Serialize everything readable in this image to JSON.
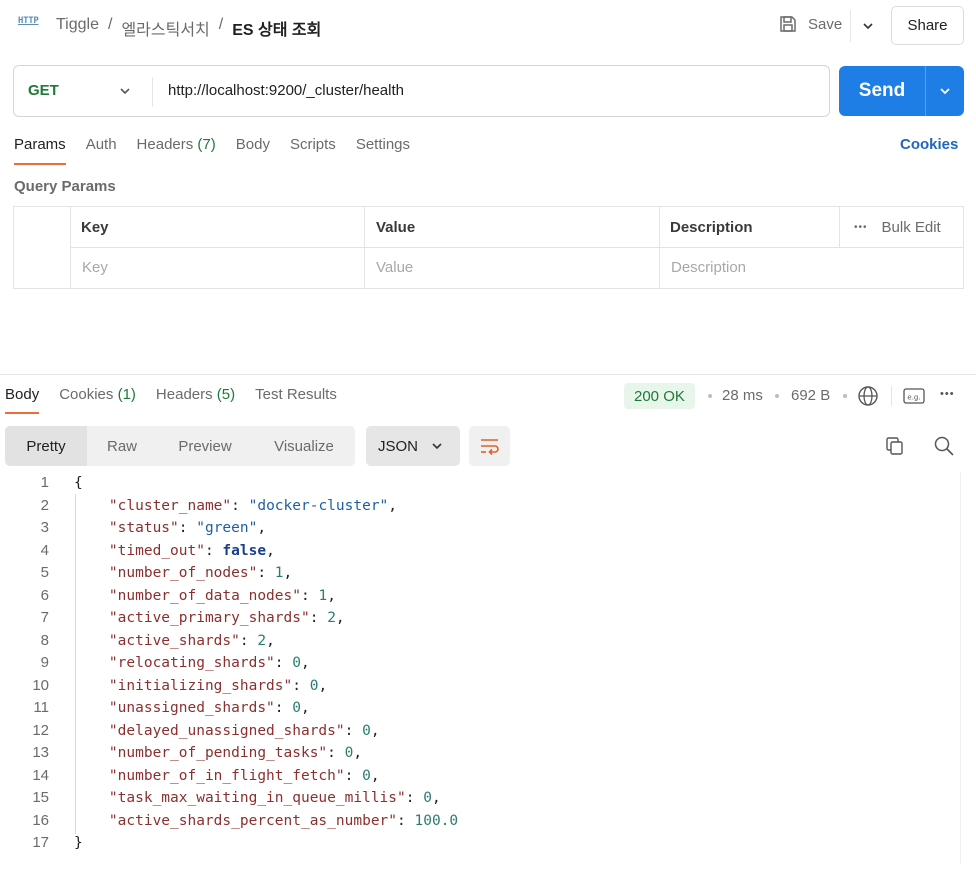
{
  "header": {
    "icon": "http-icon",
    "icon_text": "HTTP",
    "breadcrumbs": [
      "Tiggle",
      "엘라스틱서치"
    ],
    "separator": "/",
    "current": "ES 상태 조회",
    "save_label": "Save",
    "share_label": "Share"
  },
  "request": {
    "method": "GET",
    "url": "http://localhost:9200/_cluster/health",
    "send_label": "Send",
    "method_color": "#1e7a3a",
    "send_color": "#1f7de6"
  },
  "request_tabs": {
    "params": "Params",
    "auth": "Auth",
    "headers": "Headers",
    "headers_count": "(7)",
    "body": "Body",
    "scripts": "Scripts",
    "settings": "Settings",
    "cookies": "Cookies"
  },
  "query_params": {
    "title": "Query Params",
    "columns": {
      "key": "Key",
      "value": "Value",
      "description": "Description",
      "bulk_edit": "Bulk Edit"
    },
    "placeholders": {
      "key": "Key",
      "value": "Value",
      "description": "Description"
    }
  },
  "response_tabs": {
    "body": "Body",
    "cookies": "Cookies",
    "cookies_count": "(1)",
    "headers": "Headers",
    "headers_count": "(5)",
    "test_results": "Test Results"
  },
  "response_meta": {
    "status": "200 OK",
    "time": "28 ms",
    "size": "692 B",
    "accent_color": "#ef6c3a"
  },
  "view": {
    "pretty": "Pretty",
    "raw": "Raw",
    "preview": "Preview",
    "visualize": "Visualize",
    "format": "JSON"
  },
  "code": {
    "line_numbers": [
      "1",
      "2",
      "3",
      "4",
      "5",
      "6",
      "7",
      "8",
      "9",
      "10",
      "11",
      "12",
      "13",
      "14",
      "15",
      "16",
      "17"
    ],
    "open_brace": "{",
    "close_brace": "}",
    "fields": [
      {
        "key": "\"cluster_name\"",
        "value": "\"docker-cluster\"",
        "type": "string",
        "trail": ","
      },
      {
        "key": "\"status\"",
        "value": "\"green\"",
        "type": "string",
        "trail": ","
      },
      {
        "key": "\"timed_out\"",
        "value": "false",
        "type": "bool",
        "trail": ","
      },
      {
        "key": "\"number_of_nodes\"",
        "value": "1",
        "type": "number",
        "trail": ","
      },
      {
        "key": "\"number_of_data_nodes\"",
        "value": "1",
        "type": "number",
        "trail": ","
      },
      {
        "key": "\"active_primary_shards\"",
        "value": "2",
        "type": "number",
        "trail": ","
      },
      {
        "key": "\"active_shards\"",
        "value": "2",
        "type": "number",
        "trail": ","
      },
      {
        "key": "\"relocating_shards\"",
        "value": "0",
        "type": "number",
        "trail": ","
      },
      {
        "key": "\"initializing_shards\"",
        "value": "0",
        "type": "number",
        "trail": ","
      },
      {
        "key": "\"unassigned_shards\"",
        "value": "0",
        "type": "number",
        "trail": ","
      },
      {
        "key": "\"delayed_unassigned_shards\"",
        "value": "0",
        "type": "number",
        "trail": ","
      },
      {
        "key": "\"number_of_pending_tasks\"",
        "value": "0",
        "type": "number",
        "trail": ","
      },
      {
        "key": "\"number_of_in_flight_fetch\"",
        "value": "0",
        "type": "number",
        "trail": ","
      },
      {
        "key": "\"task_max_waiting_in_queue_millis\"",
        "value": "0",
        "type": "number",
        "trail": ","
      },
      {
        "key": "\"active_shards_percent_as_number\"",
        "value": "100.0",
        "type": "number",
        "trail": ""
      }
    ]
  }
}
